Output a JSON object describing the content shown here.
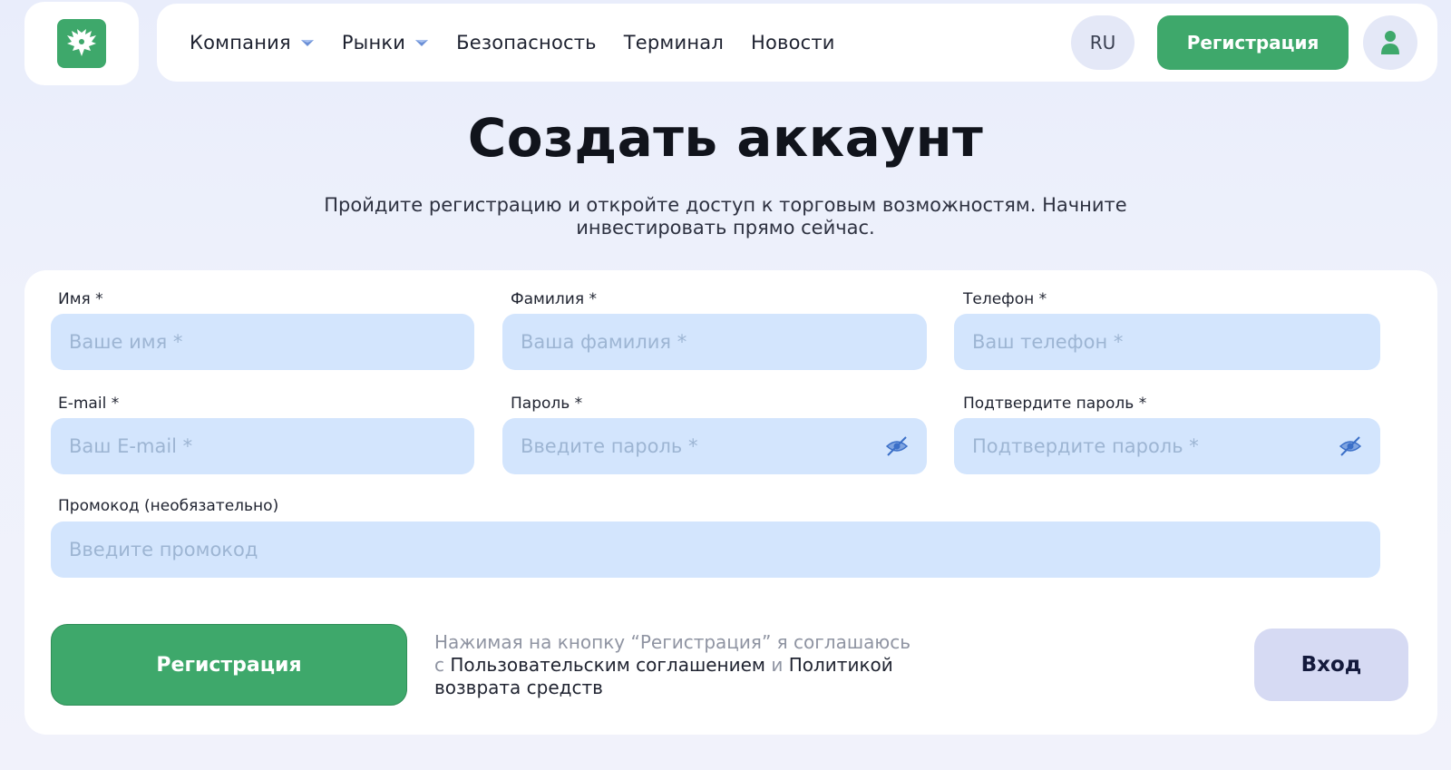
{
  "header": {
    "nav": [
      {
        "label": "Компания",
        "has_dropdown": true
      },
      {
        "label": "Рынки",
        "has_dropdown": true
      },
      {
        "label": "Безопасность",
        "has_dropdown": false
      },
      {
        "label": "Терминал",
        "has_dropdown": false
      },
      {
        "label": "Новости",
        "has_dropdown": false
      }
    ],
    "language": "RU",
    "register_label": "Регистрация"
  },
  "page": {
    "title": "Создать аккаунт",
    "subtitle_line1": "Пройдите регистрацию и откройте доступ к торговым возможностям. Начните",
    "subtitle_line2": "инвестировать прямо сейчас."
  },
  "form": {
    "first_name": {
      "label": "Имя *",
      "placeholder": "Ваше имя *",
      "value": ""
    },
    "last_name": {
      "label": "Фамилия *",
      "placeholder": "Ваша фамилия *",
      "value": ""
    },
    "phone": {
      "label": "Телефон *",
      "placeholder": "Ваш телефон *",
      "value": ""
    },
    "email": {
      "label": "E-mail *",
      "placeholder": "Ваш E-mail *",
      "value": ""
    },
    "password": {
      "label": "Пароль *",
      "placeholder": "Введите пароль *",
      "value": ""
    },
    "confirm_password": {
      "label": "Подтвердите пароль *",
      "placeholder": "Подтвердите пароль *",
      "value": ""
    },
    "promo": {
      "label": "Промокод (необязательно)",
      "placeholder": "Введите промокод",
      "value": ""
    },
    "submit_label": "Регистрация",
    "legal": {
      "line1": "Нажимая на кнопку “Регистрация” я соглашаюсь",
      "prefix": "с ",
      "agreement_link": "Пользовательским соглашением",
      "conjunction": " и ",
      "policy_link": "Политикой",
      "line3": "возврата средств"
    },
    "login_label": "Вход"
  },
  "colors": {
    "accent_green": "#3ea86b",
    "field_bg": "#d3e5fd",
    "page_bg": "#eef1fb",
    "login_bg": "#d6daf3"
  },
  "icons": {
    "logo": "eagle-logo-icon",
    "dropdown": "chevron-down-icon",
    "user": "user-icon",
    "password_toggle": "eye-off-icon"
  }
}
